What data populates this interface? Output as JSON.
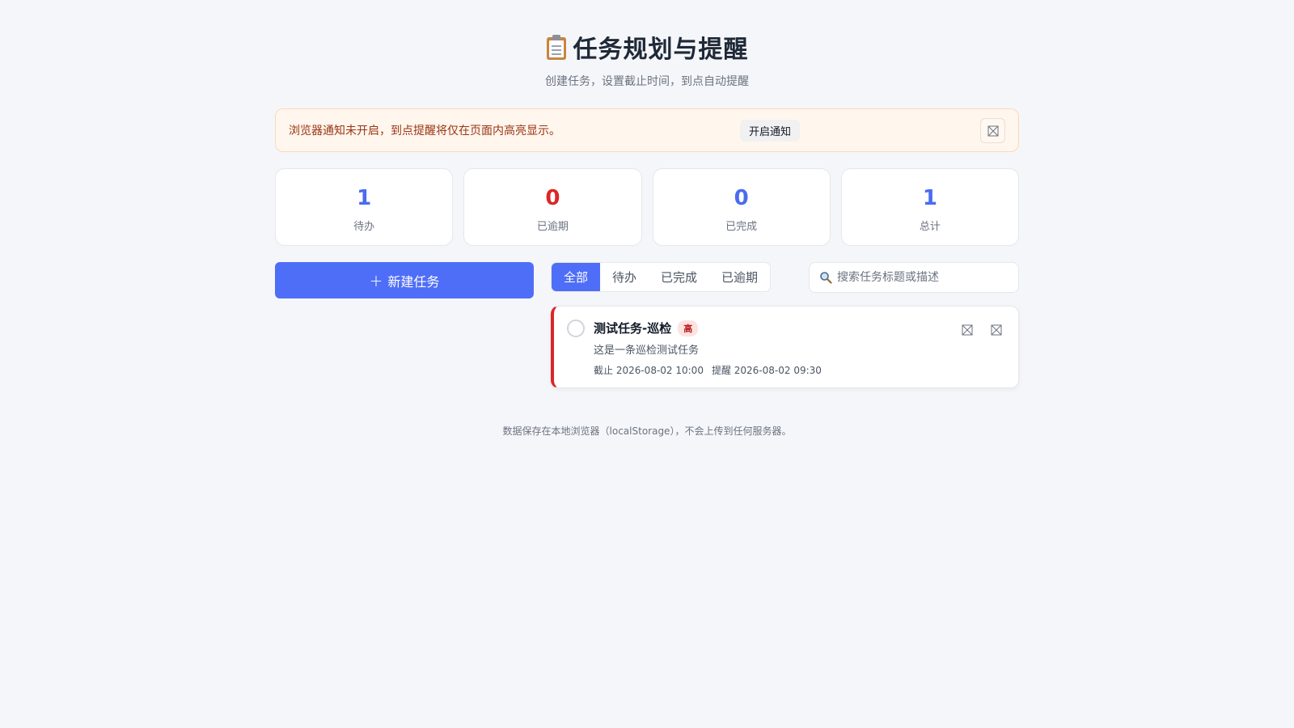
{
  "header": {
    "title": "任务规划与提醒",
    "subtitle": "创建任务，设置截止时间，到点自动提醒"
  },
  "notice": {
    "text": "浏览器通知未开启，到点提醒将仅在页面内高亮显示。",
    "enable_label": "开启通知"
  },
  "stats": [
    {
      "value": "1",
      "label": "待办",
      "color": "#4a6cf0"
    },
    {
      "value": "0",
      "label": "已逾期",
      "color": "#dc2626"
    },
    {
      "value": "0",
      "label": "已完成",
      "color": "#4a6cf0"
    },
    {
      "value": "1",
      "label": "总计",
      "color": "#4a6cf0"
    }
  ],
  "toolbar": {
    "new_task_label": "新建任务",
    "tabs": [
      {
        "label": "全部",
        "active": true
      },
      {
        "label": "待办",
        "active": false
      },
      {
        "label": "已完成",
        "active": false
      },
      {
        "label": "已逾期",
        "active": false
      }
    ],
    "search_placeholder": "搜索任务标题或描述"
  },
  "tasks": [
    {
      "title": "测试任务-巡检",
      "priority": "高",
      "description": "这是一条巡检测试任务",
      "due": "截止 2026-08-02 10:00",
      "remind": "提醒 2026-08-02 09:30"
    }
  ],
  "footer": {
    "text": "数据保存在本地浏览器（localStorage），不会上传到任何服务器。"
  },
  "colors": {
    "accent": "#4f6ef7",
    "danger": "#dc2626",
    "notice_bg": "#fff6ed"
  }
}
